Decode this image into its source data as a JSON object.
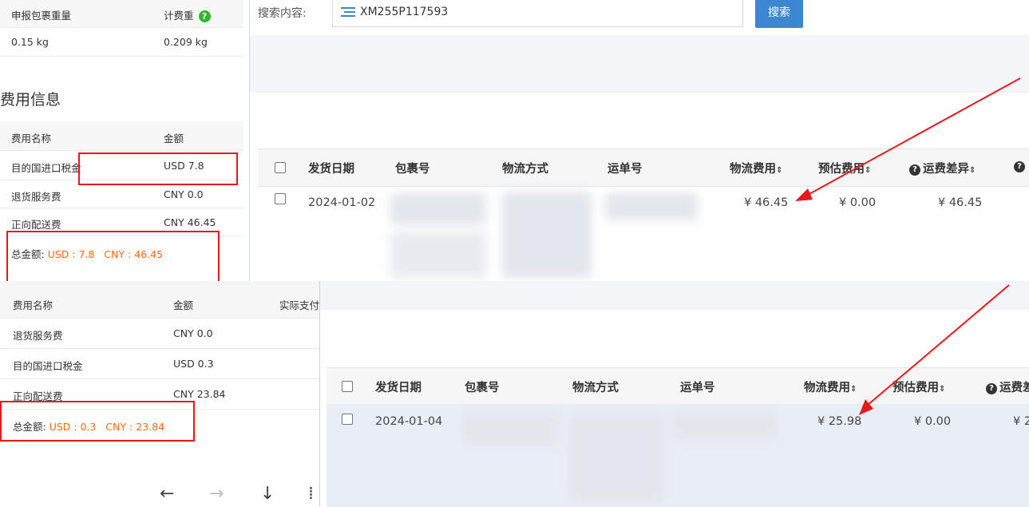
{
  "weight": {
    "declared_label": "申报包裹重量",
    "billed_label": "计费重",
    "help_icon": "?",
    "declared_value": "0.15 kg",
    "billed_value": "0.209 kg"
  },
  "fee_section": {
    "title": "费用信息"
  },
  "fee_table_1": {
    "col_name": "费用名称",
    "col_amount": "金额",
    "rows": [
      {
        "name": "目的国进口税金",
        "amount": "USD 7.8"
      },
      {
        "name": "退货服务费",
        "amount": "CNY 0.0"
      },
      {
        "name": "正向配送费",
        "amount": "CNY 46.45"
      }
    ],
    "total_label": "总金额:",
    "total_value": "USD : 7.8   CNY : 46.45"
  },
  "fee_table_2": {
    "col_name": "费用名称",
    "col_amount": "金额",
    "col_paid": "实际支付",
    "rows": [
      {
        "name": "退货服务费",
        "amount": "CNY 0.0"
      },
      {
        "name": "目的国进口税金",
        "amount": "USD 0.3"
      },
      {
        "name": "正向配送费",
        "amount": "CNY 23.84"
      }
    ],
    "total_label": "总金额:",
    "total_value": "USD : 0.3   CNY : 23.84"
  },
  "search": {
    "label": "搜索内容:",
    "value": "XM255P117593",
    "button": "搜索",
    "filter_icon": "list-filter-icon"
  },
  "shipment_table_1": {
    "headers": {
      "date": "发货日期",
      "package": "包裹号",
      "method": "物流方式",
      "waybill": "运单号",
      "logistics_fee": "物流费用",
      "estimated_fee": "预估费用",
      "diff": "运费差异"
    },
    "row": {
      "date": "2024-01-02",
      "logistics_fee": "¥ 46.45",
      "estimated_fee": "¥ 0.00",
      "diff": "¥ 46.45"
    }
  },
  "shipment_table_2": {
    "headers": {
      "date": "发货日期",
      "package": "包裹号",
      "method": "物流方式",
      "waybill": "运单号",
      "logistics_fee": "物流费用",
      "estimated_fee": "预估费用",
      "diff": "运费差"
    },
    "row": {
      "date": "2024-01-04",
      "logistics_fee": "¥ 25.98",
      "estimated_fee": "¥ 0.00",
      "diff": "¥ 2"
    }
  },
  "sort_glyph": "⇕",
  "nav": {
    "back": "←",
    "forward": "→",
    "down": "↓",
    "more": "⁞"
  },
  "colors": {
    "highlight_box": "#e8191c",
    "total_text": "#ff6a13",
    "search_button": "#3d86d0",
    "help_green": "#2eb82e"
  }
}
